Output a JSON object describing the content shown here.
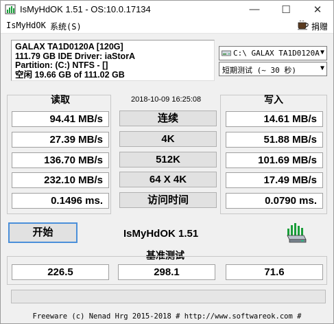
{
  "window": {
    "title": "IsMyHdOK 1.51 - OS:10.0.17134",
    "controls": {
      "minimize": "—",
      "maximize": "☐",
      "close": "✕"
    }
  },
  "menu": {
    "items": [
      "IsMyHdOK",
      "系统(S)"
    ],
    "donate_label": "捐赠",
    "donate_icon": "coffee-cup-icon"
  },
  "drive_info": {
    "model": "GALAX TA1D0120A [120G]",
    "size_driver": "111.79 GB  IDE Driver: iaStorA",
    "partition": "Partition: (C:) NTFS - []",
    "free": "空闲 19.66 GB of 111.02 GB"
  },
  "drive_select": {
    "value": "C:\\ GALAX TA1D0120A",
    "icon": "hard-drive-icon"
  },
  "test_select": {
    "value": "短期测试 (~ 30 秒)"
  },
  "read": {
    "label": "读取",
    "values": [
      "94.41 MB/s",
      "27.39 MB/s",
      "136.70 MB/s",
      "232.10 MB/s",
      "0.1496 ms."
    ]
  },
  "write": {
    "label": "写入",
    "values": [
      "14.61 MB/s",
      "51.88 MB/s",
      "101.69 MB/s",
      "17.49 MB/s",
      "0.0790 ms."
    ]
  },
  "timestamp": "2018-10-09 16:25:08",
  "modes": [
    "连续",
    "4K",
    "512K",
    "64 X 4K",
    "访问时间"
  ],
  "start_label": "开始",
  "app_name": "IsMyHdOK 1.51",
  "benchmark": {
    "label": "基准测试",
    "values": [
      "226.5",
      "298.1",
      "71.6"
    ]
  },
  "progress": {
    "fraction": 0.0
  },
  "footer": "Freeware (c) Nenad Hrg 2015-2018 # http://www.softwareok.com   #",
  "colors": {
    "accent": "#4a8fd9",
    "progress": "#06b025",
    "logo": "#1a9e3a"
  }
}
